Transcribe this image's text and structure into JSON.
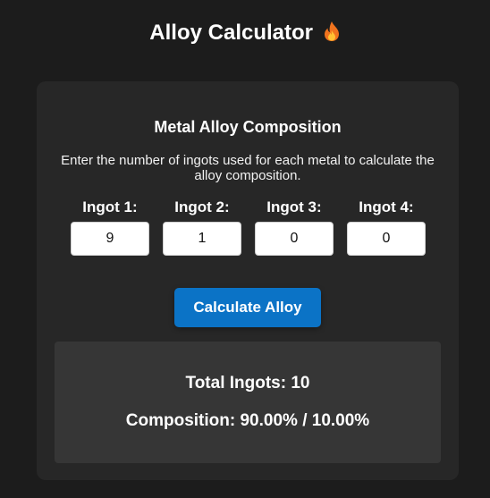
{
  "header": {
    "title": "Alloy Calculator",
    "title_icon": "fire-icon"
  },
  "card": {
    "title": "Metal Alloy Composition",
    "description": "Enter the number of ingots used for each metal to calculate the alloy composition."
  },
  "ingots": [
    {
      "label": "Ingot 1:",
      "value": "9"
    },
    {
      "label": "Ingot 2:",
      "value": "1"
    },
    {
      "label": "Ingot 3:",
      "value": "0"
    },
    {
      "label": "Ingot 4:",
      "value": "0"
    }
  ],
  "actions": {
    "calculate_label": "Calculate Alloy"
  },
  "result": {
    "total_text": "Total Ingots: 10",
    "composition_text": "Composition: 90.00% / 10.00%"
  },
  "colors": {
    "page_background": "#1c1c1c",
    "card_background": "#272727",
    "result_background": "#363636",
    "button_accent": "#0b73c6"
  }
}
